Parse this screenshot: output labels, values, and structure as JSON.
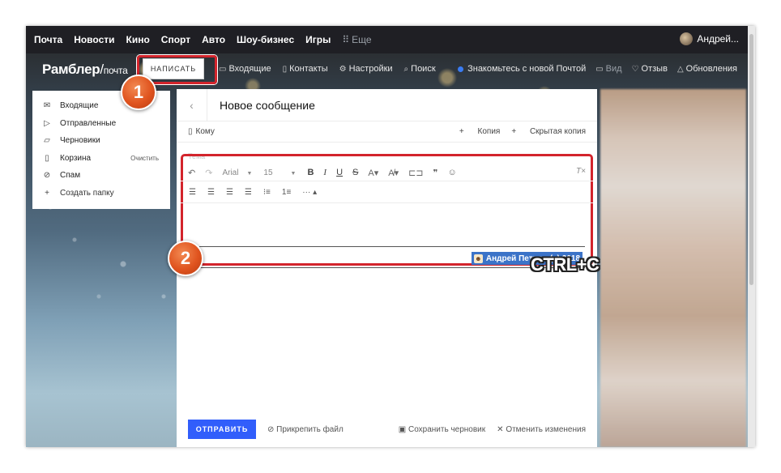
{
  "topbar": {
    "links": [
      "Почта",
      "Новости",
      "Кино",
      "Спорт",
      "Авто",
      "Шоу-бизнес",
      "Игры"
    ],
    "more_label": "Еще",
    "user_name": "Андрей..."
  },
  "header": {
    "logo_main": "Рамблер",
    "logo_slash": "/",
    "logo_sub": "почта",
    "compose_label": "НАПИСАТЬ",
    "nav": {
      "inbox": "Входящие",
      "contacts": "Контакты",
      "settings": "Настройки",
      "search": "Поиск"
    },
    "right": {
      "promo": "Знакомьтесь с новой Почтой",
      "view": "Вид",
      "feedback": "Отзыв",
      "updates": "Обновления"
    }
  },
  "sidebar": {
    "inbox": "Входящие",
    "sent": "Отправленные",
    "drafts": "Черновики",
    "trash": "Корзина",
    "trash_action": "Очистить",
    "spam": "Спам",
    "create_folder": "Создать папку"
  },
  "compose": {
    "title": "Новое сообщение",
    "to_label": "Кому",
    "cc_label": "Копия",
    "bcc_label": "Скрытая копия",
    "subject_placeholder": "Тема",
    "toolbar": {
      "font": "Arial",
      "size": "15"
    },
    "signature": "Андрей Петров (c) 2018",
    "send_label": "ОТПРАВИТЬ",
    "attach_label": "Прикрепить файл",
    "save_draft_label": "Сохранить черновик",
    "cancel_label": "Отменить изменения"
  },
  "annotations": {
    "badge1": "1",
    "badge2": "2",
    "shortcut": "CTRL+C",
    "highlight_color": "#d3242c",
    "badge_color": "#e0541f"
  },
  "colors": {
    "accent": "#315efb",
    "topbar_bg": "#1f1f24",
    "selection": "#3b73c8"
  }
}
